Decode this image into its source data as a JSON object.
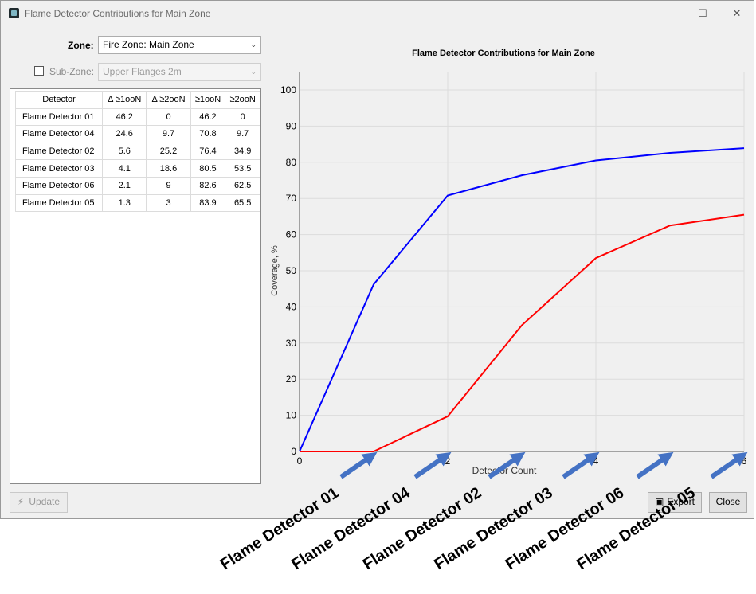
{
  "window": {
    "title": "Flame Detector Contributions for Main Zone",
    "minimize": "—",
    "maximize": "☐",
    "close": "✕"
  },
  "zone": {
    "label": "Zone:",
    "value": "Fire Zone: Main Zone"
  },
  "subzone": {
    "label": "Sub-Zone:",
    "value": "Upper Flanges 2m"
  },
  "table": {
    "headers": [
      "Detector",
      "Δ ≥1ooN",
      "Δ ≥2ooN",
      "≥1ooN",
      "≥2ooN"
    ],
    "rows": [
      [
        "Flame Detector 01",
        "46.2",
        "0",
        "46.2",
        "0"
      ],
      [
        "Flame Detector 04",
        "24.6",
        "9.7",
        "70.8",
        "9.7"
      ],
      [
        "Flame Detector 02",
        "5.6",
        "25.2",
        "76.4",
        "34.9"
      ],
      [
        "Flame Detector 03",
        "4.1",
        "18.6",
        "80.5",
        "53.5"
      ],
      [
        "Flame Detector 06",
        "2.1",
        "9",
        "82.6",
        "62.5"
      ],
      [
        "Flame Detector 05",
        "1.3",
        "3",
        "83.9",
        "65.5"
      ]
    ]
  },
  "buttons": {
    "update": "Update",
    "export": "Export",
    "close": "Close"
  },
  "chart_data": {
    "type": "line",
    "title": "Flame Detector Contributions for Main Zone",
    "xlabel": "Detector Count",
    "ylabel": "Coverage, %",
    "xlim": [
      0,
      6
    ],
    "ylim": [
      0,
      100
    ],
    "xticks": [
      0,
      2,
      4,
      6
    ],
    "yticks": [
      0,
      10,
      20,
      30,
      40,
      50,
      60,
      70,
      80,
      90,
      100
    ],
    "grid": true,
    "x": [
      0,
      1,
      2,
      3,
      4,
      5,
      6
    ],
    "series": [
      {
        "color": "#0000ff",
        "values": [
          0,
          46.2,
          70.8,
          76.4,
          80.5,
          82.6,
          83.9
        ]
      },
      {
        "color": "#ff0000",
        "values": [
          0,
          0,
          9.7,
          34.9,
          53.5,
          62.5,
          65.5
        ]
      }
    ]
  },
  "annotations": {
    "color": "#4472c4",
    "labels": [
      "Flame Detector 01",
      "Flame Detector 04",
      "Flame Detector 02",
      "Flame Detector 03",
      "Flame Detector 06",
      "Flame Detector 05"
    ]
  }
}
